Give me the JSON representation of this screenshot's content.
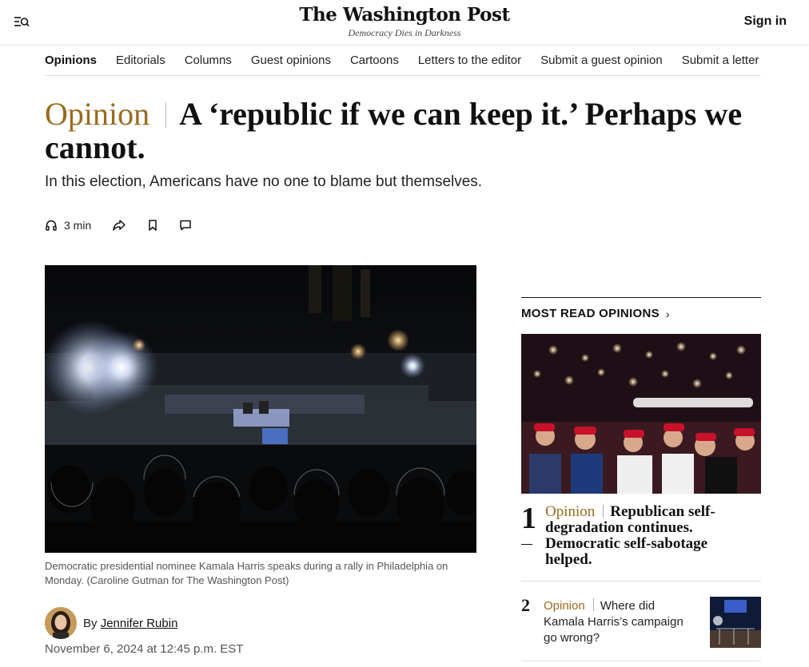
{
  "header": {
    "logo": "The Washington Post",
    "tagline": "Democracy Dies in Darkness",
    "sign_in": "Sign in"
  },
  "subnav": {
    "items": [
      "Opinions",
      "Editorials",
      "Columns",
      "Guest opinions",
      "Cartoons",
      "Letters to the editor",
      "Submit a guest opinion",
      "Submit a letter"
    ]
  },
  "article": {
    "kicker": "Opinion",
    "headline": "A ‘republic if we can keep it.’ Perhaps we cannot.",
    "dek": "In this election, Americans have no one to blame but themselves.",
    "listen_time": "3 min",
    "caption": "Democratic presidential nominee Kamala Harris speaks during a rally in Philadelphia on Monday. (Caroline Gutman for The Washington Post)",
    "byline_prefix": "By",
    "author": "Jennifer Rubin",
    "date": "November 6, 2024 at 12:45 p.m. EST"
  },
  "sidebar": {
    "title": "MOST READ OPINIONS",
    "chevron": "›",
    "items": [
      {
        "num": "1",
        "kicker": "Opinion",
        "title": "Republican self-degradation continues. Democratic self-sabotage helped."
      },
      {
        "num": "2",
        "kicker": "Opinion",
        "title": "Where did Kamala Harris’s campaign go wrong?"
      }
    ]
  },
  "colors": {
    "accent": "#9a6a1d",
    "text": "#111111",
    "rule": "#e3e3e3"
  }
}
